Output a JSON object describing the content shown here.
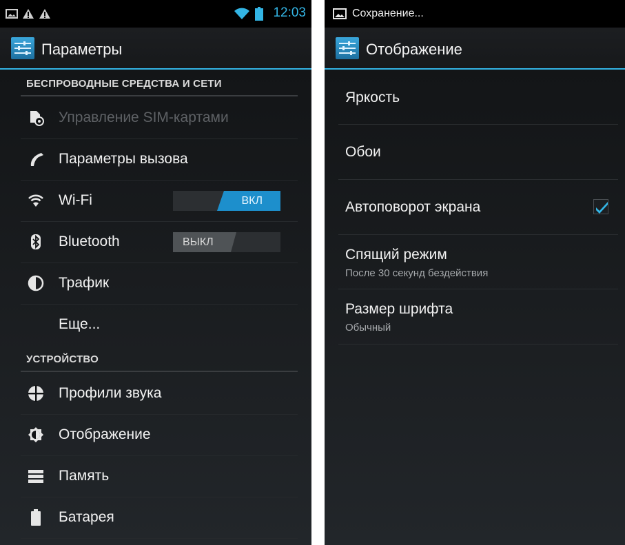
{
  "left": {
    "status": {
      "time": "12:03",
      "icons": [
        "picture-icon",
        "warning-icon",
        "warning-icon",
        "wifi-icon",
        "battery-icon"
      ]
    },
    "title": "Параметры",
    "sections": [
      {
        "header": "БЕСПРОВОДНЫЕ СРЕДСТВА И СЕТИ"
      },
      {
        "header": "УСТРОЙСТВО"
      }
    ],
    "items": [
      {
        "label": "Управление SIM-картами",
        "icon": "sim-icon",
        "enabled": false
      },
      {
        "label": "Параметры вызова",
        "icon": "phone-icon"
      },
      {
        "label": "Wi-Fi",
        "icon": "wifi-icon",
        "toggle": "ВКЛ"
      },
      {
        "label": "Bluetooth",
        "icon": "bluetooth-icon",
        "toggle": "ВЫКЛ"
      },
      {
        "label": "Трафик",
        "icon": "data-usage-icon"
      },
      {
        "label": "Еще..."
      },
      {
        "label": "Профили звука",
        "icon": "sound-profile-icon"
      },
      {
        "label": "Отображение",
        "icon": "display-icon"
      },
      {
        "label": "Память",
        "icon": "storage-icon"
      },
      {
        "label": "Батарея",
        "icon": "battery-icon"
      }
    ]
  },
  "right": {
    "status": {
      "text": "Сохранение...",
      "icon": "picture-icon"
    },
    "title": "Отображение",
    "items": [
      {
        "title": "Яркость"
      },
      {
        "title": "Обои"
      },
      {
        "title": "Автоповорот экрана",
        "checked": true
      },
      {
        "title": "Спящий режим",
        "summary": "После 30 секунд бездействия"
      },
      {
        "title": "Размер шрифта",
        "summary": "Обычный"
      }
    ]
  },
  "colors": {
    "accent": "#33b5e5",
    "toggle_on": "#1d8fcc",
    "background": "#101214"
  }
}
